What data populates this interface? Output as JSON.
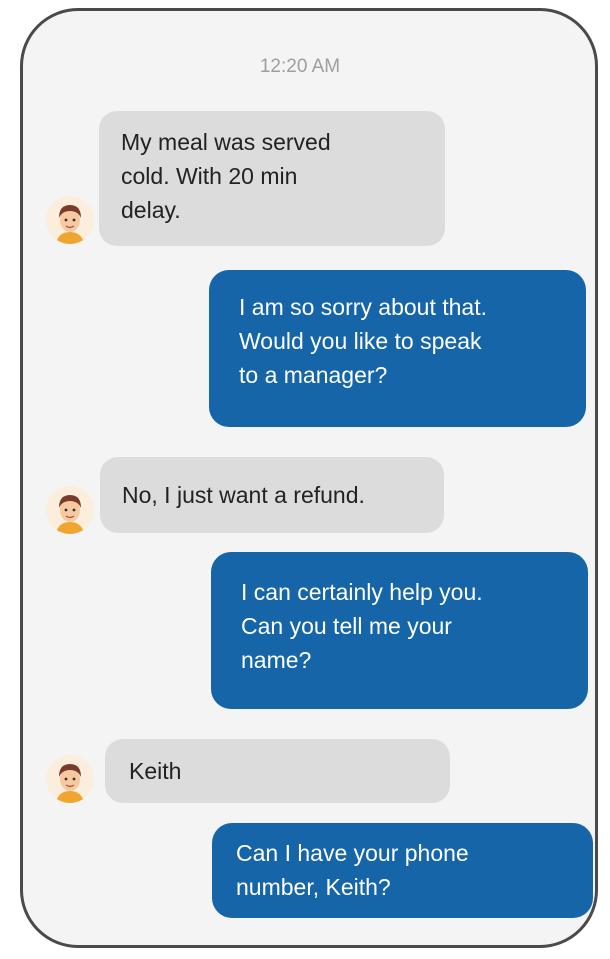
{
  "chat": {
    "timestamp": "12:20 AM",
    "messages": [
      {
        "sender": "customer",
        "text": "My meal was served\ncold.  With 20 min\ndelay."
      },
      {
        "sender": "agent",
        "text": "I am so sorry about that.\nWould you like to speak\nto a manager?"
      },
      {
        "sender": "customer",
        "text": "No, I just want a refund."
      },
      {
        "sender": "agent",
        "text": "I can certainly help you.\nCan you tell me your\nname?"
      },
      {
        "sender": "customer",
        "text": "Keith"
      },
      {
        "sender": "agent",
        "text": "Can I have your phone\nnumber, Keith?"
      }
    ]
  },
  "icons": {
    "customer_avatar": "user-avatar-icon"
  },
  "colors": {
    "incoming_bubble": "#dcdcdc",
    "outgoing_bubble": "#1565a8",
    "frame_border": "#4a4a4a",
    "timestamp": "#9e9e9e"
  }
}
